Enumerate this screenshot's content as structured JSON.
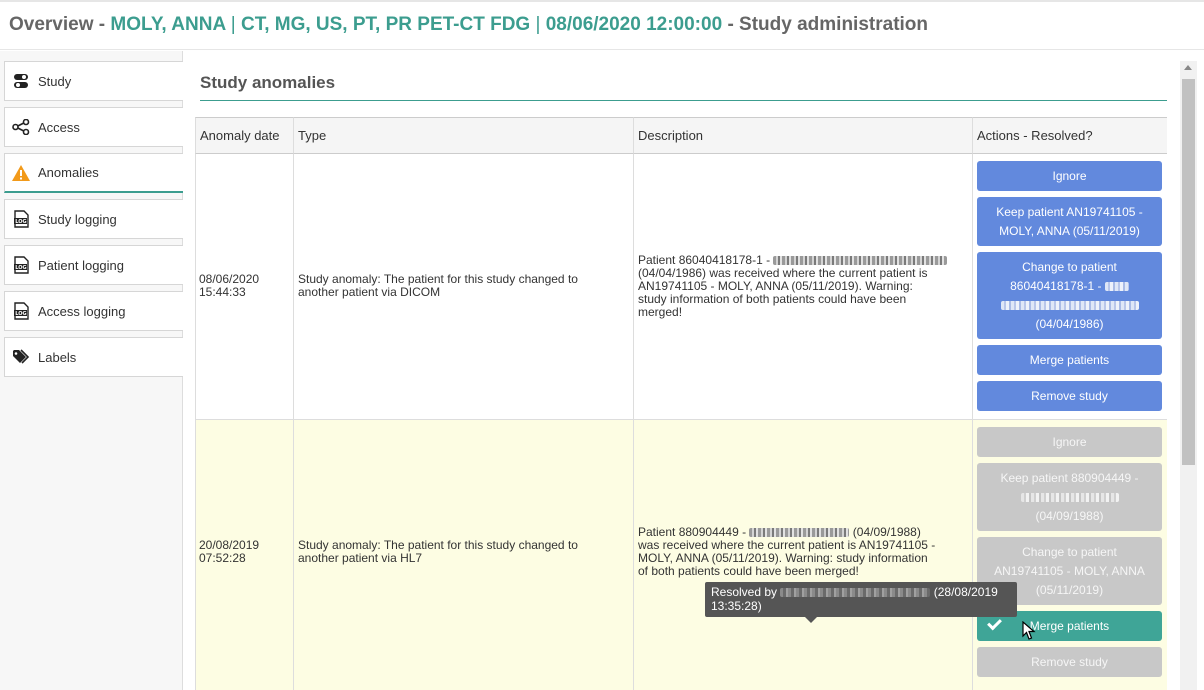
{
  "header": {
    "overview": "Overview",
    "dash1": "-",
    "patient_name": "MOLY, ANNA",
    "sep": "|",
    "modalities": "CT, MG, US, PT, PR PET-CT FDG",
    "study_date": "08/06/2020 12:00:00",
    "dash2": "-",
    "page": "Study administration"
  },
  "sidebar": {
    "items": [
      {
        "label": "Study",
        "icon": "toggle-icon"
      },
      {
        "label": "Access",
        "icon": "share-icon"
      },
      {
        "label": "Anomalies",
        "icon": "warning-icon"
      },
      {
        "label": "Study logging",
        "icon": "log-file-icon"
      },
      {
        "label": "Patient logging",
        "icon": "log-file-icon"
      },
      {
        "label": "Access logging",
        "icon": "log-file-icon"
      },
      {
        "label": "Labels",
        "icon": "tags-icon"
      }
    ]
  },
  "section": {
    "title": "Study anomalies"
  },
  "table": {
    "headers": [
      "Anomaly date",
      "Type",
      "Description",
      "Actions - Resolved?"
    ],
    "rows": [
      {
        "date_line1": "08/06/2020",
        "date_line2": "15:44:33",
        "type_line1": "Study anomaly: The patient for this study changed to",
        "type_line2": "another patient via DICOM",
        "desc_line1_prefix": "Patient 86040418178-1 -",
        "desc_line2": "(04/04/1986) was received where the current patient is",
        "desc_line3": "AN19741105 - MOLY, ANNA (05/11/2019). Warning:",
        "desc_line4": "study information of both patients could have been",
        "desc_line5": "merged!",
        "actions": {
          "ignore": "Ignore",
          "keep_line1": "Keep patient AN19741105 -",
          "keep_line2": "MOLY, ANNA (05/11/2019)",
          "change_line1": "Change to patient",
          "change_line2": "86040418178-1 -",
          "change_line4": "(04/04/1986)",
          "merge": "Merge patients",
          "remove": "Remove study"
        }
      },
      {
        "date_line1": "20/08/2019",
        "date_line2": "07:52:28",
        "type_line1": "Study anomaly: The patient for this study changed to",
        "type_line2": "another patient via HL7",
        "desc_line1_prefix": "Patient 880904449 -",
        "desc_line1_suffix": "(04/09/1988)",
        "desc_line2": "was received where the current patient is AN19741105 -",
        "desc_line3": "MOLY, ANNA (05/11/2019). Warning: study information",
        "desc_line4": "of both patients could have been merged!",
        "actions": {
          "ignore": "Ignore",
          "keep_line1": "Keep patient 880904449 -",
          "keep_line3": "(04/09/1988)",
          "change_line1": "Change to patient",
          "change_line2": "AN19741105 - MOLY, ANNA",
          "change_line3": "(05/11/2019)",
          "merge": "Merge patients",
          "remove": "Remove study"
        }
      }
    ]
  },
  "tooltip": {
    "prefix": "Resolved by",
    "suffix": "(28/08/2019",
    "line2": "13:35:28)"
  },
  "colors": {
    "accent": "#3c9d8f",
    "action_blue": "#6289dd",
    "resolved_green": "#3fa597",
    "disabled_gray": "#c8c8c8",
    "resolved_row_bg": "#fdfde3"
  }
}
